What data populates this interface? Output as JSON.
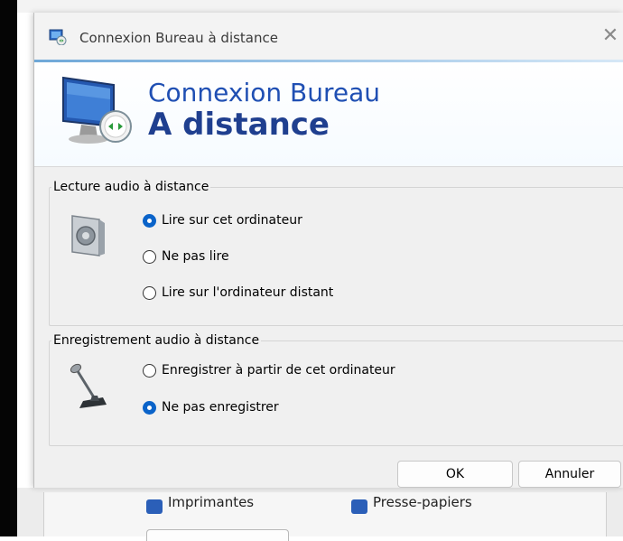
{
  "window": {
    "title": "Connexion Bureau à distance",
    "close_glyph": "✕"
  },
  "banner": {
    "line1": "Connexion Bureau",
    "line2": "A distance"
  },
  "playback": {
    "legend": "Lecture audio à distance",
    "options": [
      {
        "label": "Lire sur cet ordinateur",
        "selected": true
      },
      {
        "label": "Ne pas lire",
        "selected": false
      },
      {
        "label": "Lire sur l'ordinateur distant",
        "selected": false
      }
    ]
  },
  "recording": {
    "legend": "Enregistrement audio à distance",
    "options": [
      {
        "label": "Enregistrer à partir de cet ordinateur",
        "selected": false
      },
      {
        "label": "Ne pas enregistrer",
        "selected": true
      }
    ]
  },
  "buttons": {
    "ok": "OK",
    "cancel": "Annuler"
  },
  "background_window": {
    "item1": "Imprimantes",
    "item2": "Presse-papiers"
  },
  "colors": {
    "accent": "#0a63c9",
    "banner_title": "#1f4fb3"
  },
  "icons": {
    "title": "remote-desktop-icon",
    "banner": "monitor-icon",
    "playback": "speaker-icon",
    "recording": "microphone-icon"
  }
}
